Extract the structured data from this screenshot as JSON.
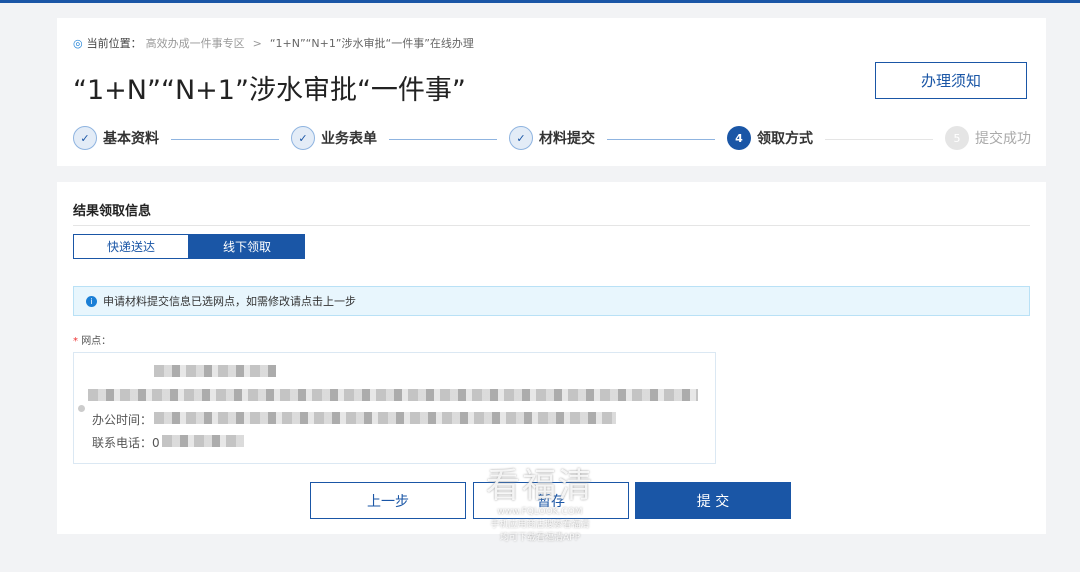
{
  "breadcrumb": {
    "label": "当前位置：",
    "items": [
      "高效办成一件事专区",
      "“1+N”“N+1”涉水审批“一件事”在线办理"
    ],
    "separator": ">"
  },
  "page_title": "“1+N”“N+1”涉水审批“一件事”",
  "notice_button": "办理须知",
  "steps": [
    {
      "label": "基本资料",
      "status": "done"
    },
    {
      "label": "业务表单",
      "status": "done"
    },
    {
      "label": "材料提交",
      "status": "done"
    },
    {
      "num": "4",
      "label": "领取方式",
      "status": "current"
    },
    {
      "num": "5",
      "label": "提交成功",
      "status": "todo"
    }
  ],
  "section_title": "结果领取信息",
  "tabs": [
    {
      "label": "快递送达",
      "active": false
    },
    {
      "label": "线下领取",
      "active": true
    }
  ],
  "info_text": "申请材料提交信息已选网点，如需修改请点击上一步",
  "field_label": "网点：",
  "office_hours_label": "办公时间：",
  "phone_label": "联系电话：",
  "phone_prefix": "0",
  "buttons": {
    "prev": "上一步",
    "save": "暂存",
    "submit": "提 交"
  },
  "watermark": {
    "logo": "看福清",
    "url": "www.FQLOOK.COM",
    "line1": "手机应用商店搜索看福清",
    "line2": "均可下载看福清APP"
  },
  "colors": {
    "primary": "#1a56a6",
    "info_bg": "#e8f6fd"
  }
}
